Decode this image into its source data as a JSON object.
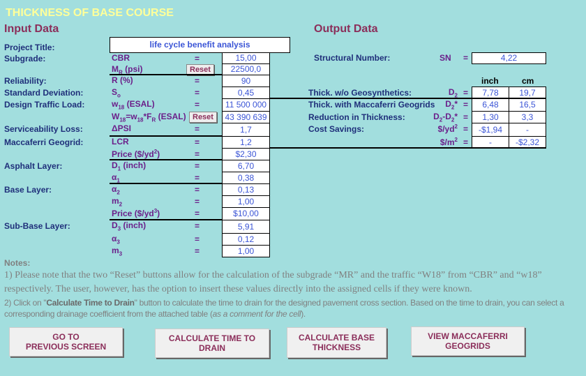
{
  "title": "THICKNESS OF BASE COURSE",
  "input_heading": "Input Data",
  "output_heading": "Output Data",
  "project_title_label": "Project Title:",
  "project_title_value": "life cycle benefit analysis",
  "reset_label": "Reset",
  "input_rows": [
    {
      "label": "Subgrade:",
      "sym": [
        {
          "t": "CBR"
        }
      ],
      "eq": "=",
      "value": "15,00"
    },
    {
      "label": "",
      "sym": [
        {
          "t": "M"
        },
        {
          "sub": "R"
        },
        {
          "t": " (psi)"
        }
      ],
      "eq": "",
      "value": "22500,0",
      "reset": true
    },
    {
      "label": "Reliability:",
      "sym": [
        {
          "t": "R (%)"
        }
      ],
      "eq": "=",
      "value": "90"
    },
    {
      "label": "Standard Deviation:",
      "sym": [
        {
          "t": "S"
        },
        {
          "sub": "o"
        }
      ],
      "eq": "=",
      "value": "0,45"
    },
    {
      "label": "Design Traffic Load:",
      "sym": [
        {
          "t": "w"
        },
        {
          "sub": "18"
        },
        {
          "t": " (ESAL)"
        }
      ],
      "eq": "=",
      "value": "11 500 000"
    },
    {
      "label": "",
      "sym": [
        {
          "t": "W"
        },
        {
          "sub": "18"
        },
        {
          "t": "=w"
        },
        {
          "sub": "18"
        },
        {
          "t": "*F"
        },
        {
          "sub": "R"
        },
        {
          "t": " (ESAL)"
        }
      ],
      "eq": "",
      "value": "43 390 639",
      "reset": true
    },
    {
      "label": "Serviceability Loss:",
      "sym": [
        {
          "t": "ΔPSI"
        }
      ],
      "eq": "=",
      "value": "1,7"
    },
    {
      "label": "Maccaferri Geogrid:",
      "sym": [
        {
          "t": " LCR"
        }
      ],
      "eq": "=",
      "value": "1,2"
    },
    {
      "label": "",
      "sym": [
        {
          "t": "Price ($/yd"
        },
        {
          "sup": "2"
        },
        {
          "t": ")"
        }
      ],
      "eq": "=",
      "value": "$2,30"
    },
    {
      "label": "Asphalt Layer:",
      "sym": [
        {
          "t": "D"
        },
        {
          "sub": "1"
        },
        {
          "t": " (inch)"
        }
      ],
      "eq": "=",
      "value": "6,70"
    },
    {
      "label": "",
      "sym": [
        {
          "t": "α"
        },
        {
          "sub": "1"
        }
      ],
      "eq": "=",
      "value": "0,38"
    },
    {
      "label": "Base Layer:",
      "sym": [
        {
          "t": "α"
        },
        {
          "sub": "2"
        }
      ],
      "eq": "=",
      "value": "0,13"
    },
    {
      "label": "",
      "sym": [
        {
          "t": "m"
        },
        {
          "sub": "2"
        }
      ],
      "eq": "=",
      "value": "1,00"
    },
    {
      "label": "",
      "sym": [
        {
          "t": "Price ($/yd"
        },
        {
          "sup": "3"
        },
        {
          "t": ")"
        }
      ],
      "eq": "=",
      "value": "$10,00"
    },
    {
      "label": "Sub-Base Layer:",
      "sym": [
        {
          "t": "D"
        },
        {
          "sub": "3"
        },
        {
          "t": " (inch)"
        }
      ],
      "eq": "=",
      "value": "5,91"
    },
    {
      "label": "",
      "sym": [
        {
          "t": "α"
        },
        {
          "sub": "3"
        }
      ],
      "eq": "=",
      "value": "0,12"
    },
    {
      "label": "",
      "sym": [
        {
          "t": "m"
        },
        {
          "sub": "3"
        }
      ],
      "eq": "=",
      "value": "1,00"
    }
  ],
  "structural_number": {
    "label": "Structural Number:",
    "sym": "SN",
    "eq": "=",
    "value": "4,22"
  },
  "unit_headers": {
    "inch": "inch",
    "cm": "cm"
  },
  "output_rows": [
    {
      "label": "Thick. w/o Geosynthetics:",
      "sym": [
        {
          "t": "D"
        },
        {
          "sub": "2"
        }
      ],
      "eq": "=",
      "inch": "7,78",
      "cm": "19,7"
    },
    {
      "label": "Thick. with Maccaferri Geogrids",
      "sym": [
        {
          "t": "D"
        },
        {
          "sub": "2"
        },
        {
          "t": "*"
        }
      ],
      "eq": "=",
      "inch": "6,48",
      "cm": "16,5"
    },
    {
      "label": "Reduction in Thickness:",
      "sym": [
        {
          "t": "D"
        },
        {
          "sub": "2"
        },
        {
          "t": "-D"
        },
        {
          "sub": "2"
        },
        {
          "t": "*"
        }
      ],
      "eq": "=",
      "inch": "1,30",
      "cm": "3,3"
    },
    {
      "label": "Cost Savings:",
      "sym": [
        {
          "t": "$/yd"
        },
        {
          "sup": "2"
        }
      ],
      "eq": "=",
      "inch": "-$1,94",
      "cm": "-"
    },
    {
      "label": "",
      "sym": [
        {
          "t": "$/m"
        },
        {
          "sup": "2"
        }
      ],
      "eq": "=",
      "inch": "-",
      "cm": "-$2,32"
    }
  ],
  "notes": {
    "heading": "Notes:",
    "note1": "1) Please note that the two “Reset” buttons allow for the calculation of the subgrade “MR” and the traffic “W18” from “CBR” and “w18” respectively. The user, however, has the option to insert these values directly into the assigned cells if they were known.",
    "note2_a": "2) Click on \"",
    "note2_b": "Calculate Time to Drain",
    "note2_c": "\" button to calculate the time to drain for the designed pavement cross section.  Based on the time to drain, you can select a corresponding drainage coefficient from the attached table (",
    "note2_d": "as a comment for the cell",
    "note2_e": ")."
  },
  "buttons": {
    "previous": "GO TO\nPREVIOUS SCREEN",
    "time_to_drain": "CALCULATE TIME TO\nDRAIN",
    "base_thickness": "CALCULATE BASE\nTHICKNESS",
    "view_geogrids": "VIEW MACCAFERRI\nGEOGRIDS"
  },
  "colors": {
    "background": "#a2dede",
    "title": "#ffff99",
    "heading": "#8b2e5a",
    "label": "#1f2f7a",
    "value": "#3b55d6"
  }
}
